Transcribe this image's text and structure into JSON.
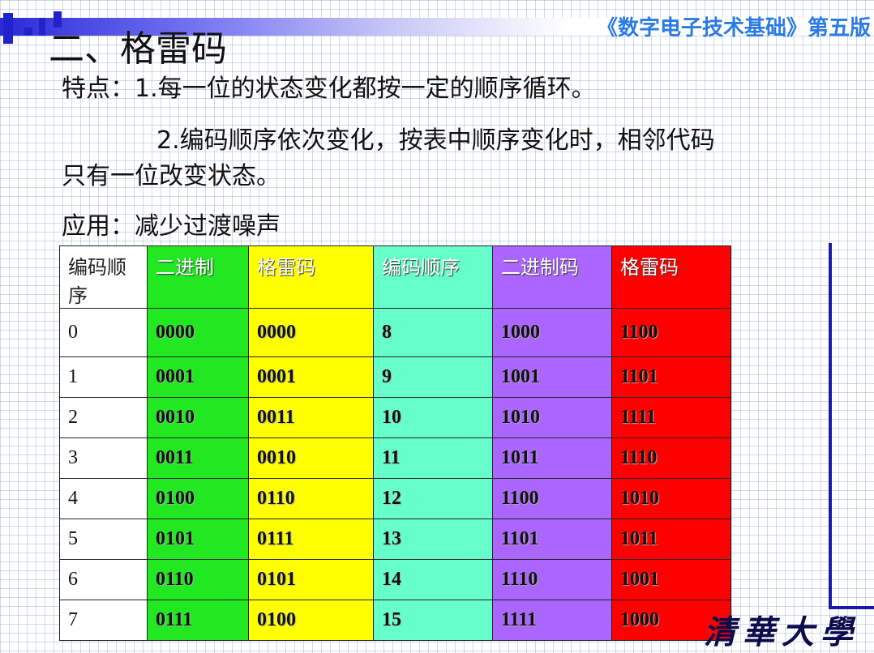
{
  "header": {
    "book_title": "《数字电子技术基础》第五版"
  },
  "section_title": "二、格雷码",
  "features": {
    "line1": "特点：1.每一位的状态变化都按一定的顺序循环。",
    "line2": "2.编码顺序依次变化，按表中顺序变化时，相邻代码",
    "line3": "只有一位改变状态。"
  },
  "application": "应用：减少过渡噪声",
  "table": {
    "headers": [
      "编码顺序",
      "二进制",
      "格雷码",
      "编码顺序",
      "二进制码",
      "格雷码"
    ],
    "rows": [
      [
        "0",
        "0000",
        "0000",
        "8",
        "1000",
        "1100"
      ],
      [
        "1",
        "0001",
        "0001",
        "9",
        "1001",
        "1101"
      ],
      [
        "2",
        "0010",
        "0011",
        "10",
        "1010",
        "1111"
      ],
      [
        "3",
        "0011",
        "0010",
        "11",
        "1011",
        "1110"
      ],
      [
        "4",
        "0100",
        "0110",
        "12",
        "1100",
        "1010"
      ],
      [
        "5",
        "0101",
        "0111",
        "13",
        "1101",
        "1011"
      ],
      [
        "6",
        "0110",
        "0101",
        "14",
        "1110",
        "1001"
      ],
      [
        "7",
        "0111",
        "0100",
        "15",
        "1111",
        "1000"
      ]
    ]
  },
  "footer_logo": "清華大學",
  "colors": {
    "binary": "#22e822",
    "gray": "#ffff00",
    "seq2": "#66ffcc",
    "binary2": "#aa66ff",
    "gray2": "#ff0000",
    "header_title": "#2a7ae8"
  }
}
